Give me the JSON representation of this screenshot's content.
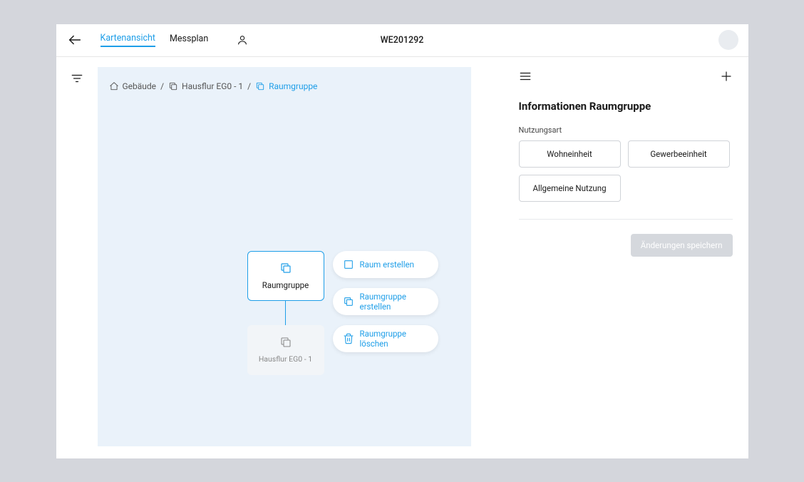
{
  "header": {
    "page_id": "WE201292",
    "tabs": {
      "map_view": "Kartenansicht",
      "messplan": "Messplan"
    }
  },
  "breadcrumbs": {
    "building": "Gebäude",
    "hallway": "Hausflur EG0 - 1",
    "room_group": "Raumgruppe"
  },
  "nodes": {
    "root_label": "Raumgruppe",
    "child_label": "Hausflur EG0 - 1"
  },
  "actions": {
    "create_room": "Raum erstellen",
    "create_group": "Raumgruppe erstellen",
    "delete_group": "Raumgruppe löschen"
  },
  "panel": {
    "title": "Informationen Raumgruppe",
    "usage_label": "Nutzungsart",
    "options": {
      "residential": "Wohneinheit",
      "commercial": "Gewerbeeinheit",
      "general": "Allgemeine Nutzung"
    },
    "save": "Änderungen speichern"
  }
}
